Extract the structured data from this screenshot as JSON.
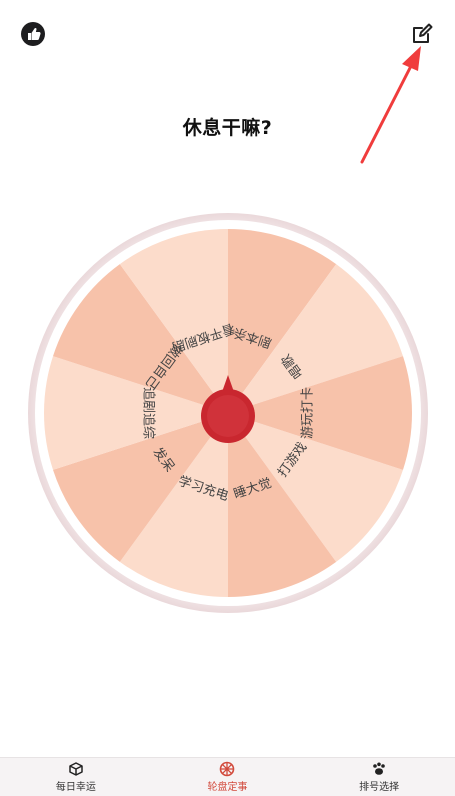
{
  "header": {
    "like_icon": "thumbs-up-icon",
    "edit_icon": "edit-icon",
    "title": "休息干嘛?"
  },
  "wheel": {
    "segments": [
      "打游戏",
      "睡大觉",
      "学习充电",
      "发呆",
      "追剧追综",
      "做回自己",
      "看平板刷剧",
      "剧本杀",
      "唱歌",
      "游玩打卡"
    ],
    "colors": {
      "light": "#fcdccb",
      "dark": "#f7c2aa",
      "rim": "#f5ebec",
      "pointer": "#c9272f"
    }
  },
  "annotation": {
    "arrow_color": "#f03c3c"
  },
  "bottom_nav": {
    "items": [
      {
        "label": "每日幸运",
        "icon": "box-icon",
        "active": false
      },
      {
        "label": "轮盘定事",
        "icon": "wheel-icon",
        "active": true
      },
      {
        "label": "排号选择",
        "icon": "paw-icon",
        "active": false
      }
    ],
    "active_color": "#d24a3c"
  }
}
